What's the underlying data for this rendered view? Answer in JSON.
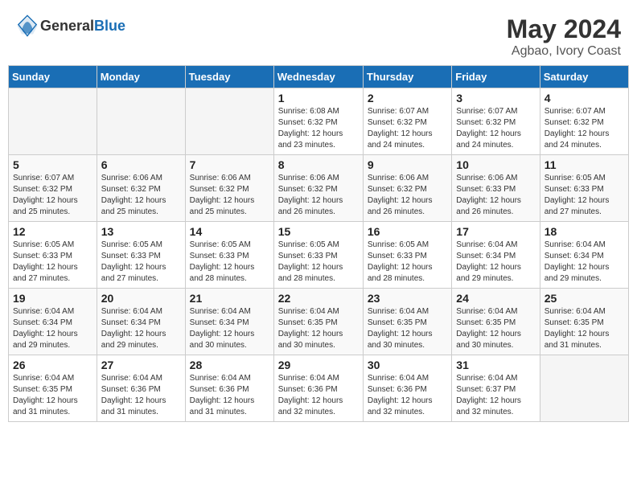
{
  "header": {
    "logo_general": "General",
    "logo_blue": "Blue",
    "month_year": "May 2024",
    "location": "Agbao, Ivory Coast"
  },
  "weekdays": [
    "Sunday",
    "Monday",
    "Tuesday",
    "Wednesday",
    "Thursday",
    "Friday",
    "Saturday"
  ],
  "weeks": [
    [
      {
        "day": "",
        "info": ""
      },
      {
        "day": "",
        "info": ""
      },
      {
        "day": "",
        "info": ""
      },
      {
        "day": "1",
        "info": "Sunrise: 6:08 AM\nSunset: 6:32 PM\nDaylight: 12 hours\nand 23 minutes."
      },
      {
        "day": "2",
        "info": "Sunrise: 6:07 AM\nSunset: 6:32 PM\nDaylight: 12 hours\nand 24 minutes."
      },
      {
        "day": "3",
        "info": "Sunrise: 6:07 AM\nSunset: 6:32 PM\nDaylight: 12 hours\nand 24 minutes."
      },
      {
        "day": "4",
        "info": "Sunrise: 6:07 AM\nSunset: 6:32 PM\nDaylight: 12 hours\nand 24 minutes."
      }
    ],
    [
      {
        "day": "5",
        "info": "Sunrise: 6:07 AM\nSunset: 6:32 PM\nDaylight: 12 hours\nand 25 minutes."
      },
      {
        "day": "6",
        "info": "Sunrise: 6:06 AM\nSunset: 6:32 PM\nDaylight: 12 hours\nand 25 minutes."
      },
      {
        "day": "7",
        "info": "Sunrise: 6:06 AM\nSunset: 6:32 PM\nDaylight: 12 hours\nand 25 minutes."
      },
      {
        "day": "8",
        "info": "Sunrise: 6:06 AM\nSunset: 6:32 PM\nDaylight: 12 hours\nand 26 minutes."
      },
      {
        "day": "9",
        "info": "Sunrise: 6:06 AM\nSunset: 6:32 PM\nDaylight: 12 hours\nand 26 minutes."
      },
      {
        "day": "10",
        "info": "Sunrise: 6:06 AM\nSunset: 6:33 PM\nDaylight: 12 hours\nand 26 minutes."
      },
      {
        "day": "11",
        "info": "Sunrise: 6:05 AM\nSunset: 6:33 PM\nDaylight: 12 hours\nand 27 minutes."
      }
    ],
    [
      {
        "day": "12",
        "info": "Sunrise: 6:05 AM\nSunset: 6:33 PM\nDaylight: 12 hours\nand 27 minutes."
      },
      {
        "day": "13",
        "info": "Sunrise: 6:05 AM\nSunset: 6:33 PM\nDaylight: 12 hours\nand 27 minutes."
      },
      {
        "day": "14",
        "info": "Sunrise: 6:05 AM\nSunset: 6:33 PM\nDaylight: 12 hours\nand 28 minutes."
      },
      {
        "day": "15",
        "info": "Sunrise: 6:05 AM\nSunset: 6:33 PM\nDaylight: 12 hours\nand 28 minutes."
      },
      {
        "day": "16",
        "info": "Sunrise: 6:05 AM\nSunset: 6:33 PM\nDaylight: 12 hours\nand 28 minutes."
      },
      {
        "day": "17",
        "info": "Sunrise: 6:04 AM\nSunset: 6:34 PM\nDaylight: 12 hours\nand 29 minutes."
      },
      {
        "day": "18",
        "info": "Sunrise: 6:04 AM\nSunset: 6:34 PM\nDaylight: 12 hours\nand 29 minutes."
      }
    ],
    [
      {
        "day": "19",
        "info": "Sunrise: 6:04 AM\nSunset: 6:34 PM\nDaylight: 12 hours\nand 29 minutes."
      },
      {
        "day": "20",
        "info": "Sunrise: 6:04 AM\nSunset: 6:34 PM\nDaylight: 12 hours\nand 29 minutes."
      },
      {
        "day": "21",
        "info": "Sunrise: 6:04 AM\nSunset: 6:34 PM\nDaylight: 12 hours\nand 30 minutes."
      },
      {
        "day": "22",
        "info": "Sunrise: 6:04 AM\nSunset: 6:35 PM\nDaylight: 12 hours\nand 30 minutes."
      },
      {
        "day": "23",
        "info": "Sunrise: 6:04 AM\nSunset: 6:35 PM\nDaylight: 12 hours\nand 30 minutes."
      },
      {
        "day": "24",
        "info": "Sunrise: 6:04 AM\nSunset: 6:35 PM\nDaylight: 12 hours\nand 30 minutes."
      },
      {
        "day": "25",
        "info": "Sunrise: 6:04 AM\nSunset: 6:35 PM\nDaylight: 12 hours\nand 31 minutes."
      }
    ],
    [
      {
        "day": "26",
        "info": "Sunrise: 6:04 AM\nSunset: 6:35 PM\nDaylight: 12 hours\nand 31 minutes."
      },
      {
        "day": "27",
        "info": "Sunrise: 6:04 AM\nSunset: 6:36 PM\nDaylight: 12 hours\nand 31 minutes."
      },
      {
        "day": "28",
        "info": "Sunrise: 6:04 AM\nSunset: 6:36 PM\nDaylight: 12 hours\nand 31 minutes."
      },
      {
        "day": "29",
        "info": "Sunrise: 6:04 AM\nSunset: 6:36 PM\nDaylight: 12 hours\nand 32 minutes."
      },
      {
        "day": "30",
        "info": "Sunrise: 6:04 AM\nSunset: 6:36 PM\nDaylight: 12 hours\nand 32 minutes."
      },
      {
        "day": "31",
        "info": "Sunrise: 6:04 AM\nSunset: 6:37 PM\nDaylight: 12 hours\nand 32 minutes."
      },
      {
        "day": "",
        "info": ""
      }
    ]
  ]
}
